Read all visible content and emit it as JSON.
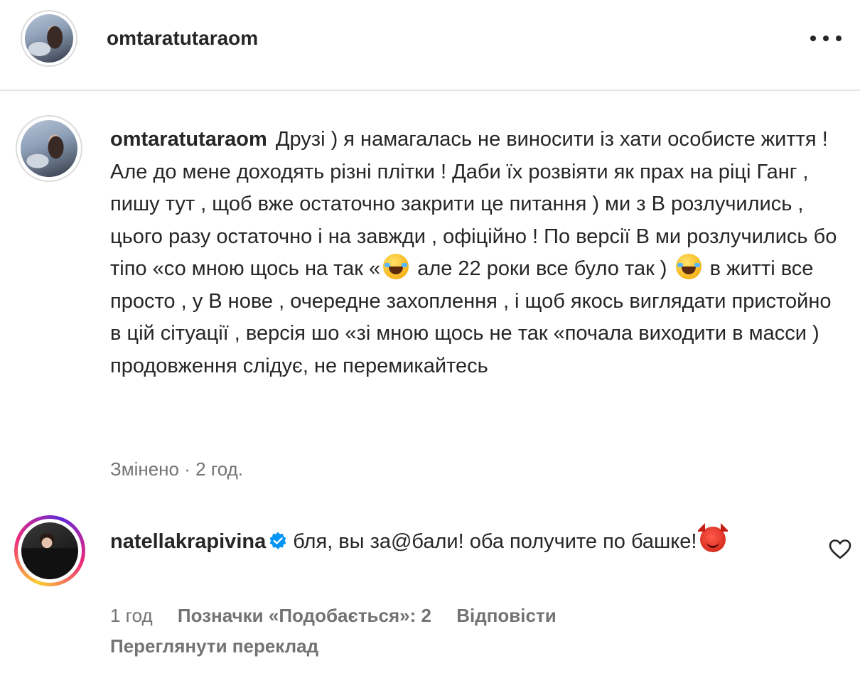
{
  "header": {
    "username": "omtaratutaraom",
    "more_icon": "more-horizontal-icon"
  },
  "post": {
    "username": "omtaratutaraom",
    "text_parts": [
      "Друзі ) я намагалась не виносити із хати особисте життя ! Але до мене доходять різні плітки ! Даби їх розвіяти як прах на ріці Ганг , пишу тут , щоб вже остаточно закрити це питання ) ми з В розлучились , цього разу остаточно і на завжди , офіційно ! По версії В ми розлучились бо тіпо «со мною щось на так «",
      " але 22 роки все було так ) ",
      " в житті все просто , у В нове , очередне захоплення , і щоб якось виглядати пристойно в цій сітуації , версія шо «зі мною щось не так «почала виходити в масси ) продовження слідує, не перемикайтесь"
    ],
    "emoji": "face-with-tears-of-joy",
    "edited_label": "Змінено",
    "separator": "·",
    "time": "2 год."
  },
  "reply": {
    "username": "natellakrapivina",
    "verified_icon": "verified-badge-icon",
    "text": "бля, вы за@бали! оба получите по башке!",
    "emoji": "smiling-face-with-horns",
    "time": "1 год",
    "likes_label": "Позначки «Подобається»: 2",
    "reply_label": "Відповісти",
    "translate_label": "Переглянути переклад",
    "like_icon": "heart-outline-icon"
  },
  "colors": {
    "text": "#262626",
    "muted": "#737373",
    "verified": "#0095f6",
    "divider": "#e3e3e3"
  }
}
